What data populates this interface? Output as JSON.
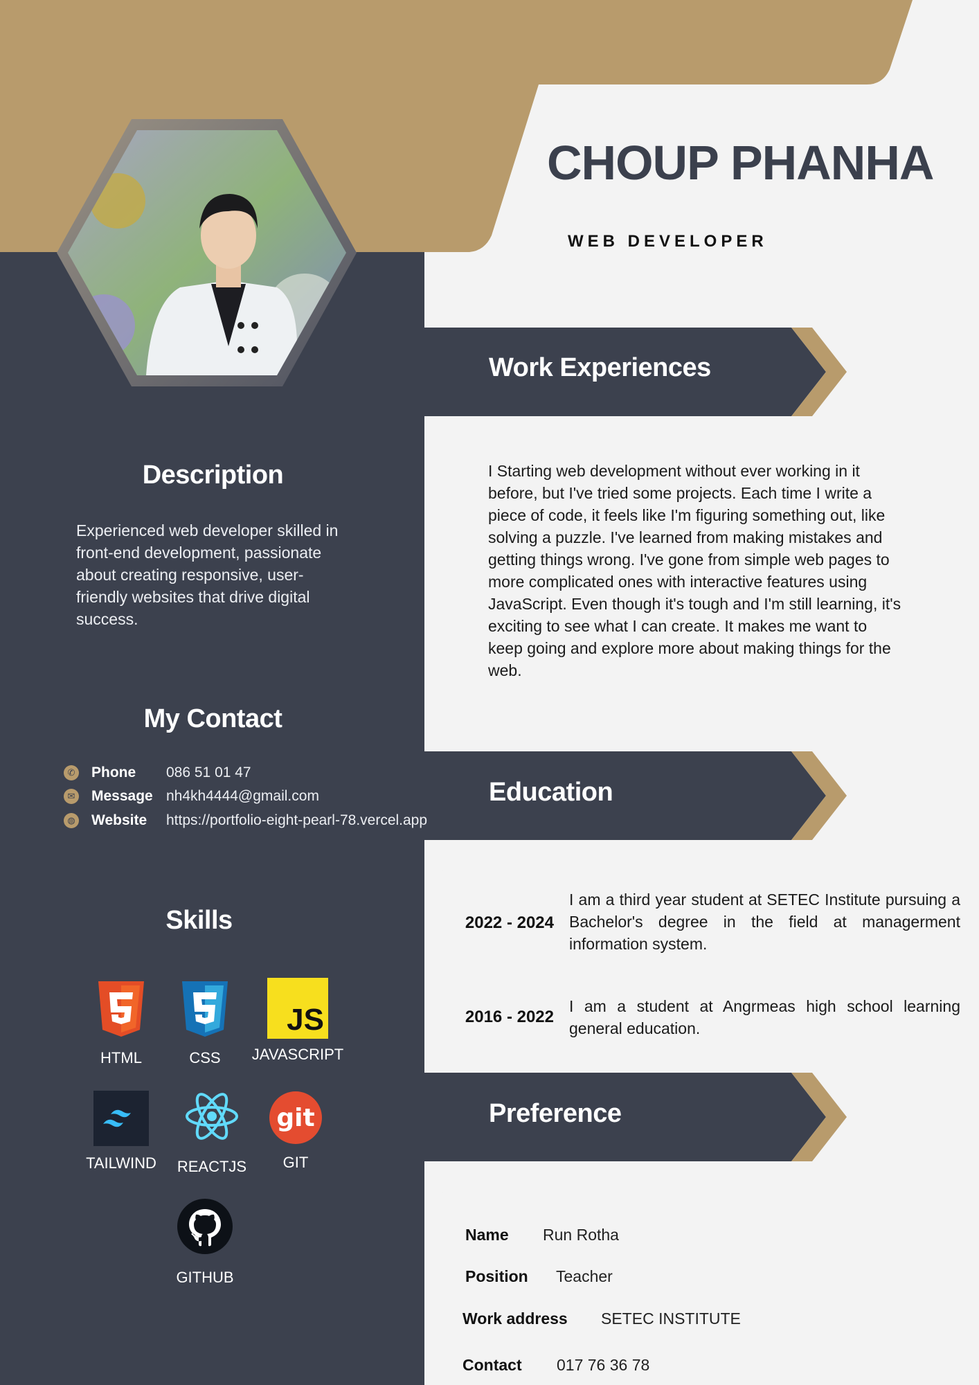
{
  "header": {
    "name": "CHOUP PHANHA",
    "role": "WEB DEVELOPER"
  },
  "colors": {
    "gold": "#b89b6c",
    "dark": "#3c414e",
    "light": "#f3f3f3"
  },
  "description": {
    "heading": "Description",
    "text": "Experienced web developer skilled in front-end development, passionate about creating responsive, user-friendly websites that drive digital success."
  },
  "contact": {
    "heading": "My Contact",
    "items": [
      {
        "icon": "phone-icon",
        "label": "Phone",
        "value": "086 51 01 47"
      },
      {
        "icon": "mail-icon",
        "label": "Message",
        "value": "nh4kh4444@gmail.com"
      },
      {
        "icon": "globe-icon",
        "label": "Website",
        "value": "https://portfolio-eight-pearl-78.vercel.app"
      }
    ]
  },
  "skills": {
    "heading": "Skills",
    "items": [
      {
        "label": "HTML",
        "icon": "html5-icon"
      },
      {
        "label": "CSS",
        "icon": "css3-icon"
      },
      {
        "label": "JAVASCRIPT",
        "icon": "javascript-icon",
        "glyph": "JS"
      },
      {
        "label": "TAILWIND",
        "icon": "tailwind-icon"
      },
      {
        "label": "REACTJS",
        "icon": "react-icon"
      },
      {
        "label": "GIT",
        "icon": "git-icon",
        "glyph": "git"
      },
      {
        "label": "GITHUB",
        "icon": "github-icon"
      }
    ]
  },
  "work": {
    "heading": "Work Experiences",
    "text": "I Starting web development without ever working in it before, but I've tried some projects. Each time I write a piece of code, it feels like I'm figuring something out, like solving a puzzle. I've learned from making mistakes and getting things wrong. I've gone from simple web pages to more complicated ones with interactive features using JavaScript. Even though it's tough and I'm still learning, it's exciting to see what I can create. It makes me want to keep going and explore more about making things for the web."
  },
  "education": {
    "heading": "Education",
    "items": [
      {
        "years": "2022 - 2024",
        "text": "I am a third year student at SETEC Institute pursuing a Bachelor's degree in the field at managerment information system."
      },
      {
        "years": "2016 - 2022",
        "text": "I am a student at Angrmeas high school learning general education."
      }
    ]
  },
  "preference": {
    "heading": "Preference",
    "items": [
      {
        "label": "Name",
        "value": "Run Rotha"
      },
      {
        "label": "Position",
        "value": "Teacher"
      },
      {
        "label": "Work address",
        "value": "SETEC INSTITUTE"
      },
      {
        "label": "Contact",
        "value": "017 76 36 78"
      }
    ]
  }
}
